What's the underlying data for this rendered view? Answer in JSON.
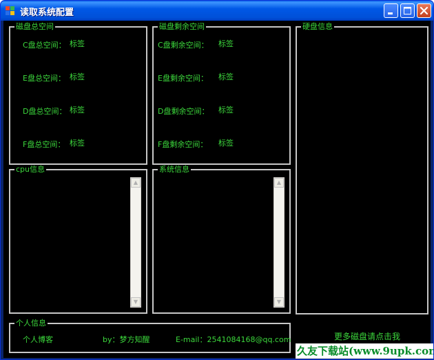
{
  "window": {
    "title": "读取系统配置"
  },
  "icons": {
    "app": "app-icon",
    "minimize": "minimize-icon",
    "maximize": "maximize-icon",
    "close": "close-icon"
  },
  "disk_total": {
    "legend": "磁盘总空间",
    "rows": [
      {
        "label": "C盘总空间：",
        "value": "标签"
      },
      {
        "label": "E盘总空间：",
        "value": "标签"
      },
      {
        "label": "D盘总空间：",
        "value": "标签"
      },
      {
        "label": "F盘总空间：",
        "value": "标签"
      }
    ]
  },
  "disk_free": {
    "legend": "磁盘剩余空间",
    "rows": [
      {
        "label": "C盘剩余空间：",
        "value": "标签"
      },
      {
        "label": "E盘剩余空间：",
        "value": "标签"
      },
      {
        "label": "D盘剩余空间：",
        "value": "标签"
      },
      {
        "label": "F盘剩余空间：",
        "value": "标签"
      }
    ]
  },
  "hdd_info": {
    "legend": "硬盘信息"
  },
  "cpu_info": {
    "legend": "cpu信息"
  },
  "sys_info": {
    "legend": "系统信息"
  },
  "personal": {
    "legend": "个人信息",
    "blog": "个人博客",
    "author": "by：梦方知醒",
    "email": "E-mail：2541084168@qq.com"
  },
  "more_link": "更多磁盘请点击我",
  "watermark": "久友下载站(www.9upk.com)",
  "colors": {
    "text_green": "#3cd73c",
    "background": "#000000",
    "titlebar": "#0058e6"
  }
}
